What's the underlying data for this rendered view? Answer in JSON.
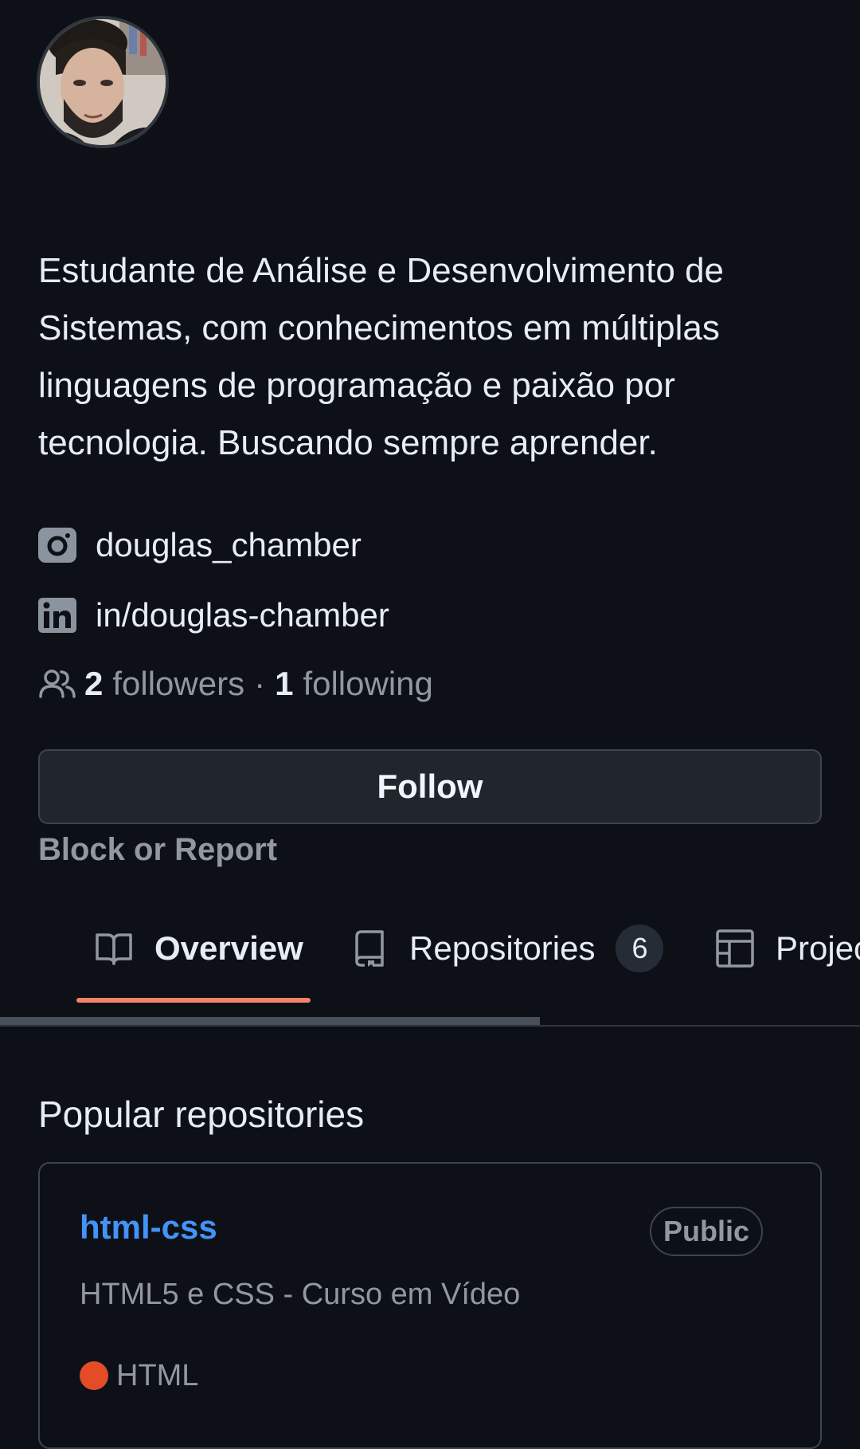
{
  "profile": {
    "bio": "Estudante de Análise e Desenvolvimento de Sistemas, com conhecimentos em múltiplas linguagens de programação e paixão por tecnologia. Buscando sempre aprender.",
    "instagram": "douglas_chamber",
    "linkedin": "in/douglas-chamber",
    "followers_count": "2",
    "followers_label": "followers",
    "separator": "·",
    "following_count": "1",
    "following_label": "following",
    "follow_button": "Follow",
    "block_report": "Block or Report"
  },
  "tabs": [
    {
      "label": "Overview",
      "icon": "book-icon",
      "selected": true
    },
    {
      "label": "Repositories",
      "icon": "repo-icon",
      "counter": "6"
    },
    {
      "label": "Projec",
      "icon": "project-table-icon"
    }
  ],
  "popular": {
    "title": "Popular repositories",
    "repos": [
      {
        "name": "html-css",
        "visibility": "Public",
        "description": "HTML5 e CSS - Curso em Vídeo",
        "language": "HTML",
        "language_color": "#e34c26"
      }
    ]
  },
  "colors": {
    "background": "#0d1117",
    "link": "#4493f8",
    "tab_underline": "#f78166",
    "muted": "#9198a1"
  }
}
